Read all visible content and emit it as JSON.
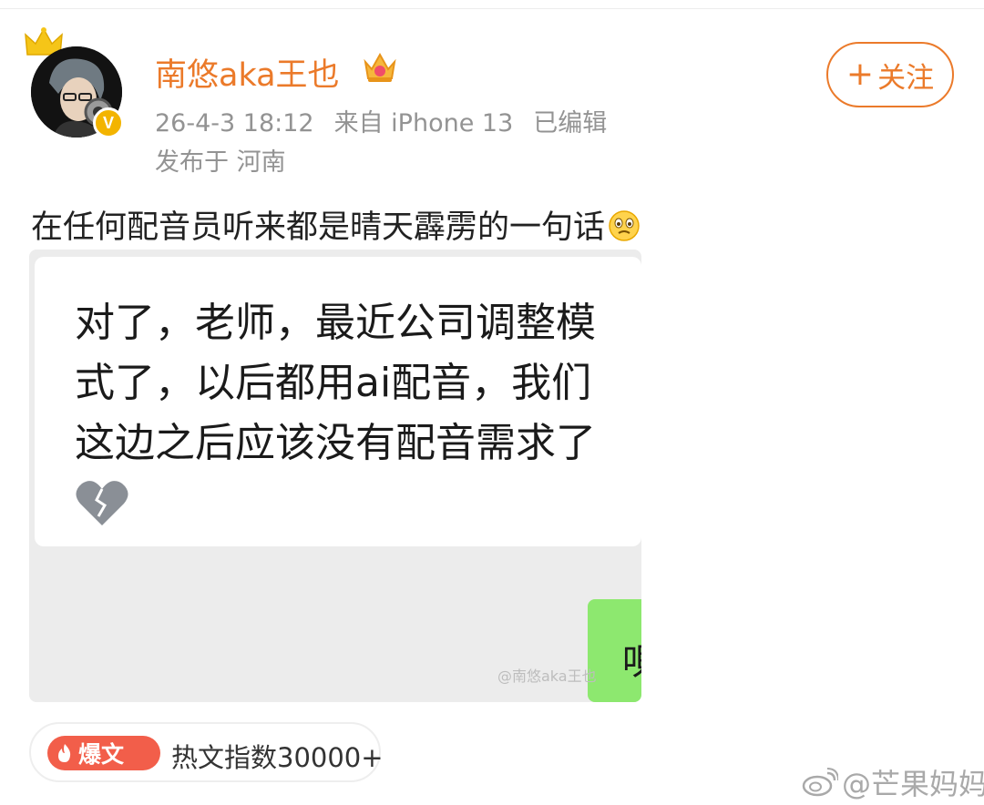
{
  "user": {
    "name": "南悠aka王也",
    "verified_badge": "V"
  },
  "meta": {
    "time": "26-4-3 18:12",
    "source": "来自 iPhone 13",
    "edited": "已编辑",
    "location": "发布于 河南"
  },
  "follow_button": {
    "plus": "+",
    "label": "关注"
  },
  "post": {
    "text": "在任何配音员听来都是晴天霹雳的一句话"
  },
  "image": {
    "message_text": "对了，老师，最近公司调整模式了，以后都用ai配音，我们这边之后应该没有配音需求了",
    "reply_fragment": "唄",
    "watermark": "@南悠aka王也"
  },
  "hot": {
    "tag": "爆文",
    "text": "热文指数30000+"
  },
  "corner_watermark": "@芒果妈妈",
  "colors": {
    "accent": "#eb7a2a",
    "meta": "#939393",
    "hot_tag": "#f25e4a",
    "chat_green": "#8de86f"
  },
  "icons": [
    "crown-icon",
    "vip-crown-icon",
    "verified-icon",
    "emoji-icon",
    "broken-heart-icon",
    "fire-icon",
    "weibo-logo-icon"
  ]
}
